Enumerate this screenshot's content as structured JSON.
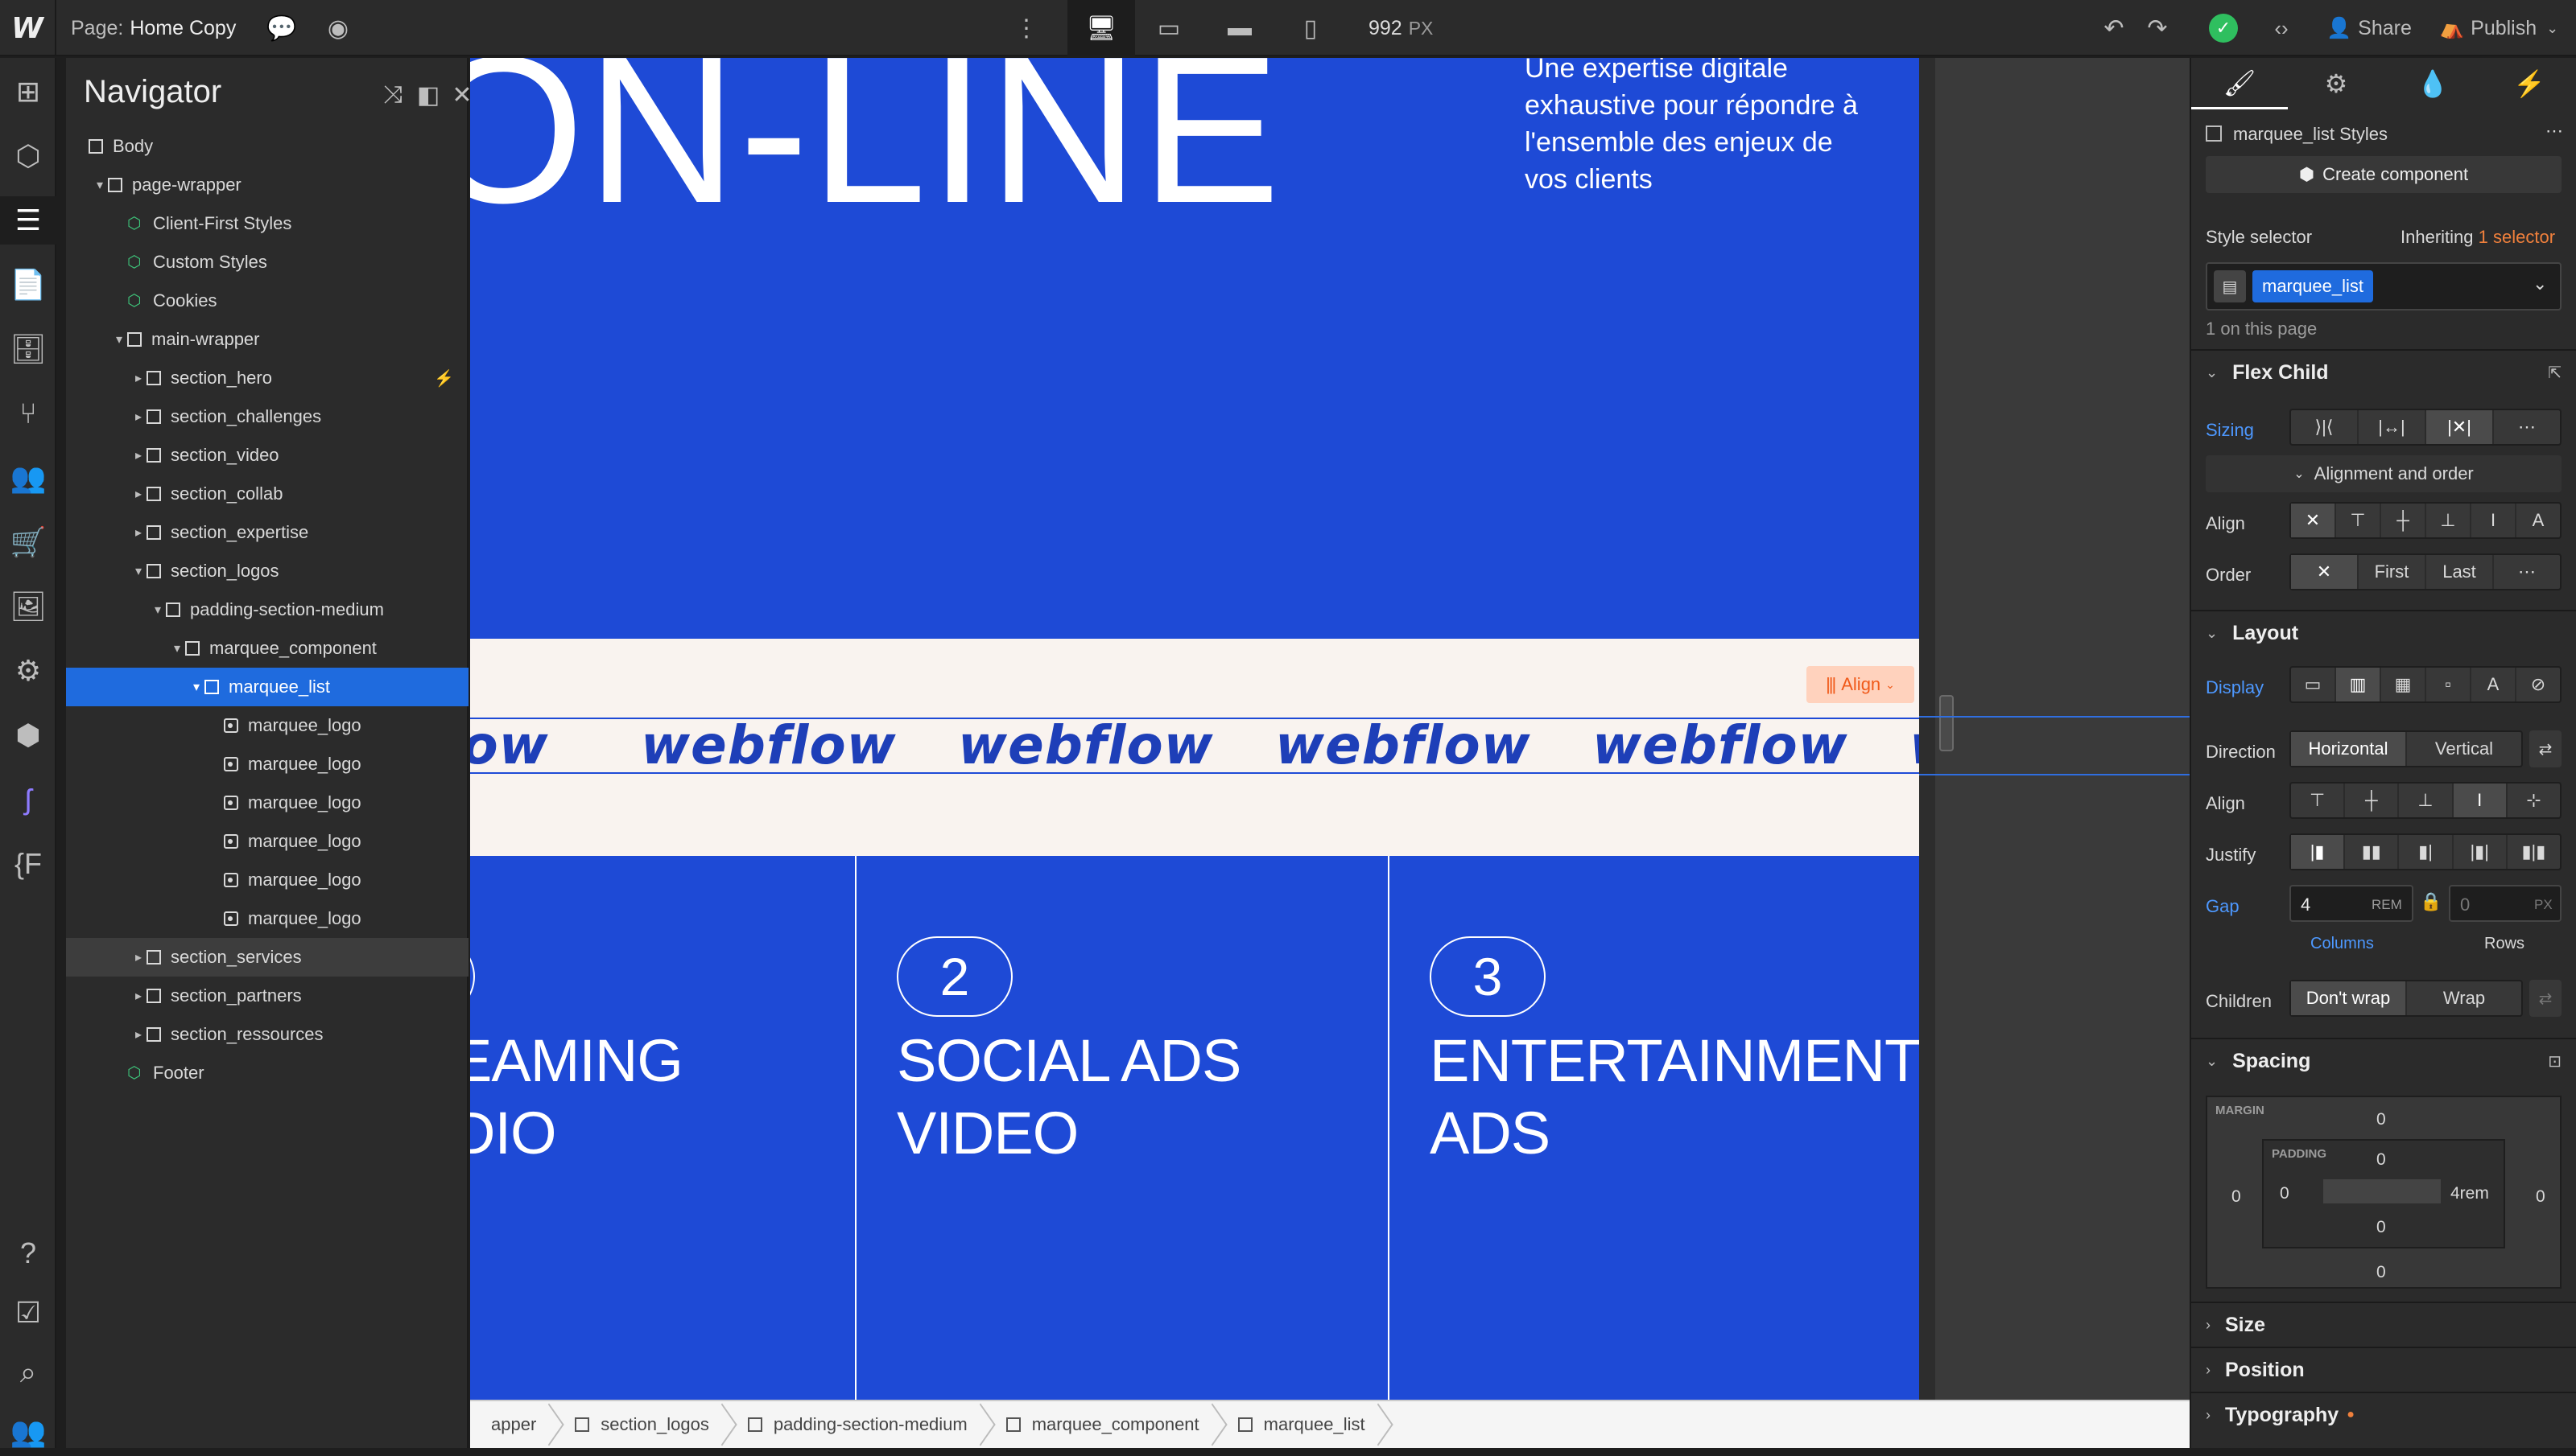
{
  "topbar": {
    "page_label": "Page:",
    "page_name": "Home Copy",
    "width_value": "992",
    "width_unit": "PX",
    "share": "Share",
    "publish": "Publish"
  },
  "navigator": {
    "title": "Navigator",
    "nodes": [
      {
        "label": "Body",
        "depth": 0,
        "kind": "box",
        "caret": ""
      },
      {
        "label": "page-wrapper",
        "depth": 1,
        "kind": "box",
        "caret": "▾"
      },
      {
        "label": "Client-First Styles",
        "depth": 2,
        "kind": "cube",
        "caret": ""
      },
      {
        "label": "Custom Styles",
        "depth": 2,
        "kind": "cube",
        "caret": ""
      },
      {
        "label": "Cookies",
        "depth": 2,
        "kind": "cube",
        "caret": ""
      },
      {
        "label": "main-wrapper",
        "depth": 2,
        "kind": "box",
        "caret": "▾"
      },
      {
        "label": "section_hero",
        "depth": 3,
        "kind": "box",
        "caret": "▸",
        "bolt": true
      },
      {
        "label": "section_challenges",
        "depth": 3,
        "kind": "box",
        "caret": "▸"
      },
      {
        "label": "section_video",
        "depth": 3,
        "kind": "box",
        "caret": "▸"
      },
      {
        "label": "section_collab",
        "depth": 3,
        "kind": "box",
        "caret": "▸"
      },
      {
        "label": "section_expertise",
        "depth": 3,
        "kind": "box",
        "caret": "▸"
      },
      {
        "label": "section_logos",
        "depth": 3,
        "kind": "box",
        "caret": "▾"
      },
      {
        "label": "padding-section-medium",
        "depth": 4,
        "kind": "box",
        "caret": "▾"
      },
      {
        "label": "marquee_component",
        "depth": 5,
        "kind": "box",
        "caret": "▾"
      },
      {
        "label": "marquee_list",
        "depth": 6,
        "kind": "box",
        "caret": "▾",
        "selected": true
      },
      {
        "label": "marquee_logo",
        "depth": 7,
        "kind": "img",
        "caret": ""
      },
      {
        "label": "marquee_logo",
        "depth": 7,
        "kind": "img",
        "caret": ""
      },
      {
        "label": "marquee_logo",
        "depth": 7,
        "kind": "img",
        "caret": ""
      },
      {
        "label": "marquee_logo",
        "depth": 7,
        "kind": "img",
        "caret": ""
      },
      {
        "label": "marquee_logo",
        "depth": 7,
        "kind": "img",
        "caret": ""
      },
      {
        "label": "marquee_logo",
        "depth": 7,
        "kind": "img",
        "caret": ""
      },
      {
        "label": "section_services",
        "depth": 3,
        "kind": "box",
        "caret": "▸",
        "hover": true
      },
      {
        "label": "section_partners",
        "depth": 3,
        "kind": "box",
        "caret": "▸"
      },
      {
        "label": "section_ressources",
        "depth": 3,
        "kind": "box",
        "caret": "▸"
      },
      {
        "label": "Footer",
        "depth": 2,
        "kind": "cube",
        "caret": ""
      }
    ]
  },
  "canvas": {
    "big_text": "ON-LINE",
    "hero_text": "Une expertise digitale exhaustive pour répondre à l'ensemble des enjeux de vos clients",
    "marquee_logo_text": "webflow",
    "align_button": "Align",
    "services": [
      {
        "num": "",
        "title": "EAMING DIO"
      },
      {
        "num": "2",
        "title": "SOCIAL ADS VIDEO"
      },
      {
        "num": "3",
        "title": "ENTERTAINMENT ADS"
      }
    ]
  },
  "breadcrumbs": [
    "apper",
    "section_logos",
    "padding-section-medium",
    "marquee_component",
    "marquee_list"
  ],
  "panel": {
    "styles_title": "marquee_list Styles",
    "create_component": "Create component",
    "style_selector": "Style selector",
    "inheriting": "Inheriting",
    "inheriting_link": "1 selector",
    "selector_chip": "marquee_list",
    "on_page": "1 on this page",
    "flex_child": "Flex Child",
    "sizing": "Sizing",
    "alignment_order": "Alignment and order",
    "align": "Align",
    "order": "Order",
    "order_first": "First",
    "order_last": "Last",
    "layout": "Layout",
    "display": "Display",
    "direction": "Direction",
    "dir_horizontal": "Horizontal",
    "dir_vertical": "Vertical",
    "justify": "Justify",
    "gap": "Gap",
    "gap_col_value": "4",
    "gap_col_unit": "REM",
    "gap_row_value": "0",
    "gap_row_unit": "PX",
    "columns": "Columns",
    "rows": "Rows",
    "children": "Children",
    "dont_wrap": "Don't wrap",
    "wrap": "Wrap",
    "spacing": "Spacing",
    "margin_label": "MARGIN",
    "padding_label": "PADDING",
    "margin": {
      "top": "0",
      "right": "0",
      "bottom": "0",
      "left": "0"
    },
    "padding": {
      "top": "0",
      "right": "4rem",
      "bottom": "0",
      "left": "0"
    },
    "size": "Size",
    "position": "Position",
    "typography": "Typography"
  },
  "colors": {
    "accent": "#1f6bde",
    "page_blue": "#1e4ad6",
    "marquee_bg": "#f9f3ef",
    "logo_blue": "#1e3fb8",
    "align_orange": "#f05a1a"
  }
}
